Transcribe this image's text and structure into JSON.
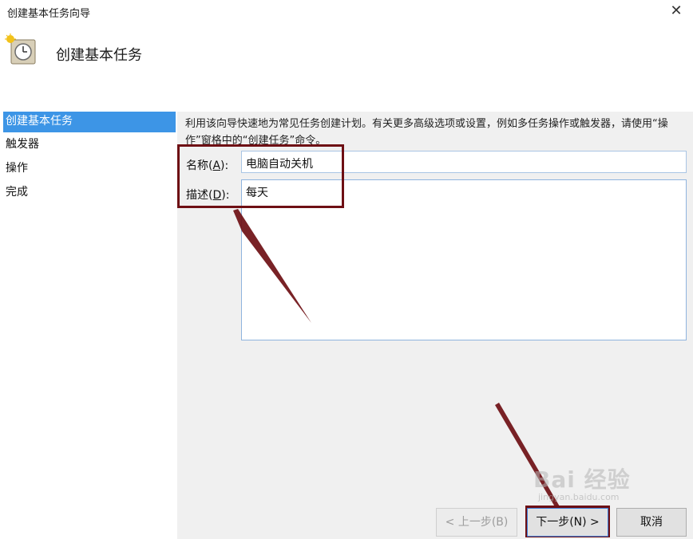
{
  "window": {
    "title": "创建基本任务向导",
    "close_symbol": "✕"
  },
  "header": {
    "heading": "创建基本任务",
    "icon": "task-clock-icon"
  },
  "sidebar": {
    "steps": [
      {
        "label": "创建基本任务",
        "active": true
      },
      {
        "label": "触发器",
        "active": false
      },
      {
        "label": "操作",
        "active": false
      },
      {
        "label": "完成",
        "active": false
      }
    ]
  },
  "main": {
    "description": "利用该向导快速地为常见任务创建计划。有关更多高级选项或设置，例如多任务操作或触发器，请使用“操作”窗格中的“创建任务”命令。",
    "name_label_text": "名称(",
    "name_label_key": "A",
    "name_label_end": "):",
    "name_value": "电脑自动关机",
    "desc_label_text": "描述(",
    "desc_label_key": "D",
    "desc_label_end": "):",
    "desc_value": "每天"
  },
  "footer": {
    "back_label": "< 上一步(B)",
    "next_label": "下一步(N) >",
    "cancel_label": "取消"
  },
  "watermark": {
    "text": "Bai 经验",
    "sub": "jingyan.baidu.com"
  },
  "colors": {
    "sidebar_active": "#3d95e6",
    "annotation": "#6e0f14",
    "content_bg": "#f0f0f0"
  }
}
